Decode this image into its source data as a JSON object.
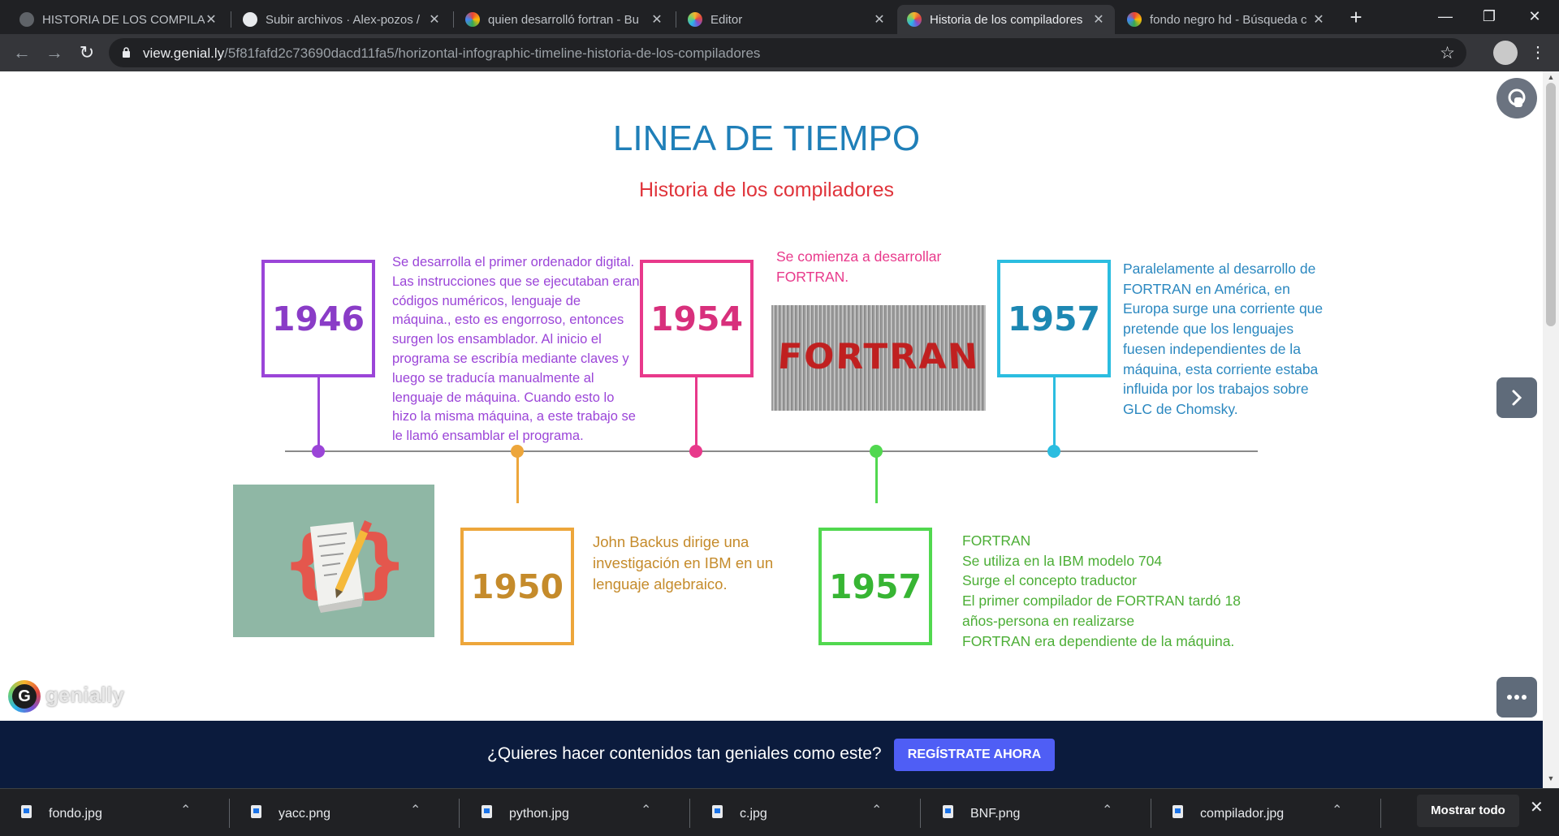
{
  "browser": {
    "tabs": [
      {
        "title": "HISTORIA DE LOS COMPILAD",
        "active": false
      },
      {
        "title": "Subir archivos · Alex-pozos /",
        "active": false
      },
      {
        "title": "quien desarrolló fortran - Bu",
        "active": false
      },
      {
        "title": "Editor",
        "active": false
      },
      {
        "title": "Historia de los compiladores",
        "active": true
      },
      {
        "title": "fondo negro hd - Búsqueda c",
        "active": false
      }
    ],
    "tab_close": "✕",
    "new_tab": "+",
    "url_host": "view.genial.ly",
    "url_path": "/5f81fafd2c73690dacd11fa5/horizontal-infographic-timeline-historia-de-los-compiladores"
  },
  "page": {
    "title": "LINEA DE TIEMPO",
    "subtitle": "Historia de los compiladores",
    "events": [
      {
        "year": "1946",
        "color": "#9b45d8",
        "text": "Se desarrolla el primer ordenador digital. Las instrucciones que se ejecutaban eran códigos numéricos, lenguaje de máquina., esto es engorroso, entonces surgen los ensamblador. Al inicio el programa se escribía mediante claves y luego se traducía manualmente al lenguaje de máquina. Cuando esto lo hizo la misma máquina, a este trabajo se le llamó ensamblar el programa."
      },
      {
        "year": "1950",
        "color": "#eda63b",
        "year_color": "#c58b2b",
        "text": "John Backus dirige una investigación en IBM en un lenguaje algebraico."
      },
      {
        "year": "1954",
        "color": "#e8398b",
        "year_color": "#d8307c",
        "text": "Se comienza a desarrollar FORTRAN."
      },
      {
        "year": "1957",
        "color": "#51d84f",
        "year_color": "#37b533",
        "text": "FORTRAN\nSe utiliza en la IBM modelo 704\nSurge el concepto traductor\nEl primer compilador de FORTRAN tardó 18 años-persona en realizarse\nFORTRAN era dependiente de la máquina."
      },
      {
        "year": "1957",
        "color": "#2bbde0",
        "year_color": "#1d88b3",
        "text": "Paralelamente al desarrollo de FORTRAN en América, en Europa surge una corriente que pretende que los lenguajes fuesen independientes de la máquina, esta corriente estaba influida por los trabajos sobre GLC de Chomsky."
      }
    ],
    "fortran_image_text": "FORTRAN",
    "logo_text": "genially",
    "banner_text": "¿Quieres hacer contenidos tan geniales como este?",
    "banner_button": "REGÍSTRATE AHORA"
  },
  "downloads": {
    "items": [
      "fondo.jpg",
      "yacc.png",
      "python.jpg",
      "c.jpg",
      "BNF.png",
      "compilador.jpg"
    ],
    "show_all": "Mostrar todo"
  }
}
